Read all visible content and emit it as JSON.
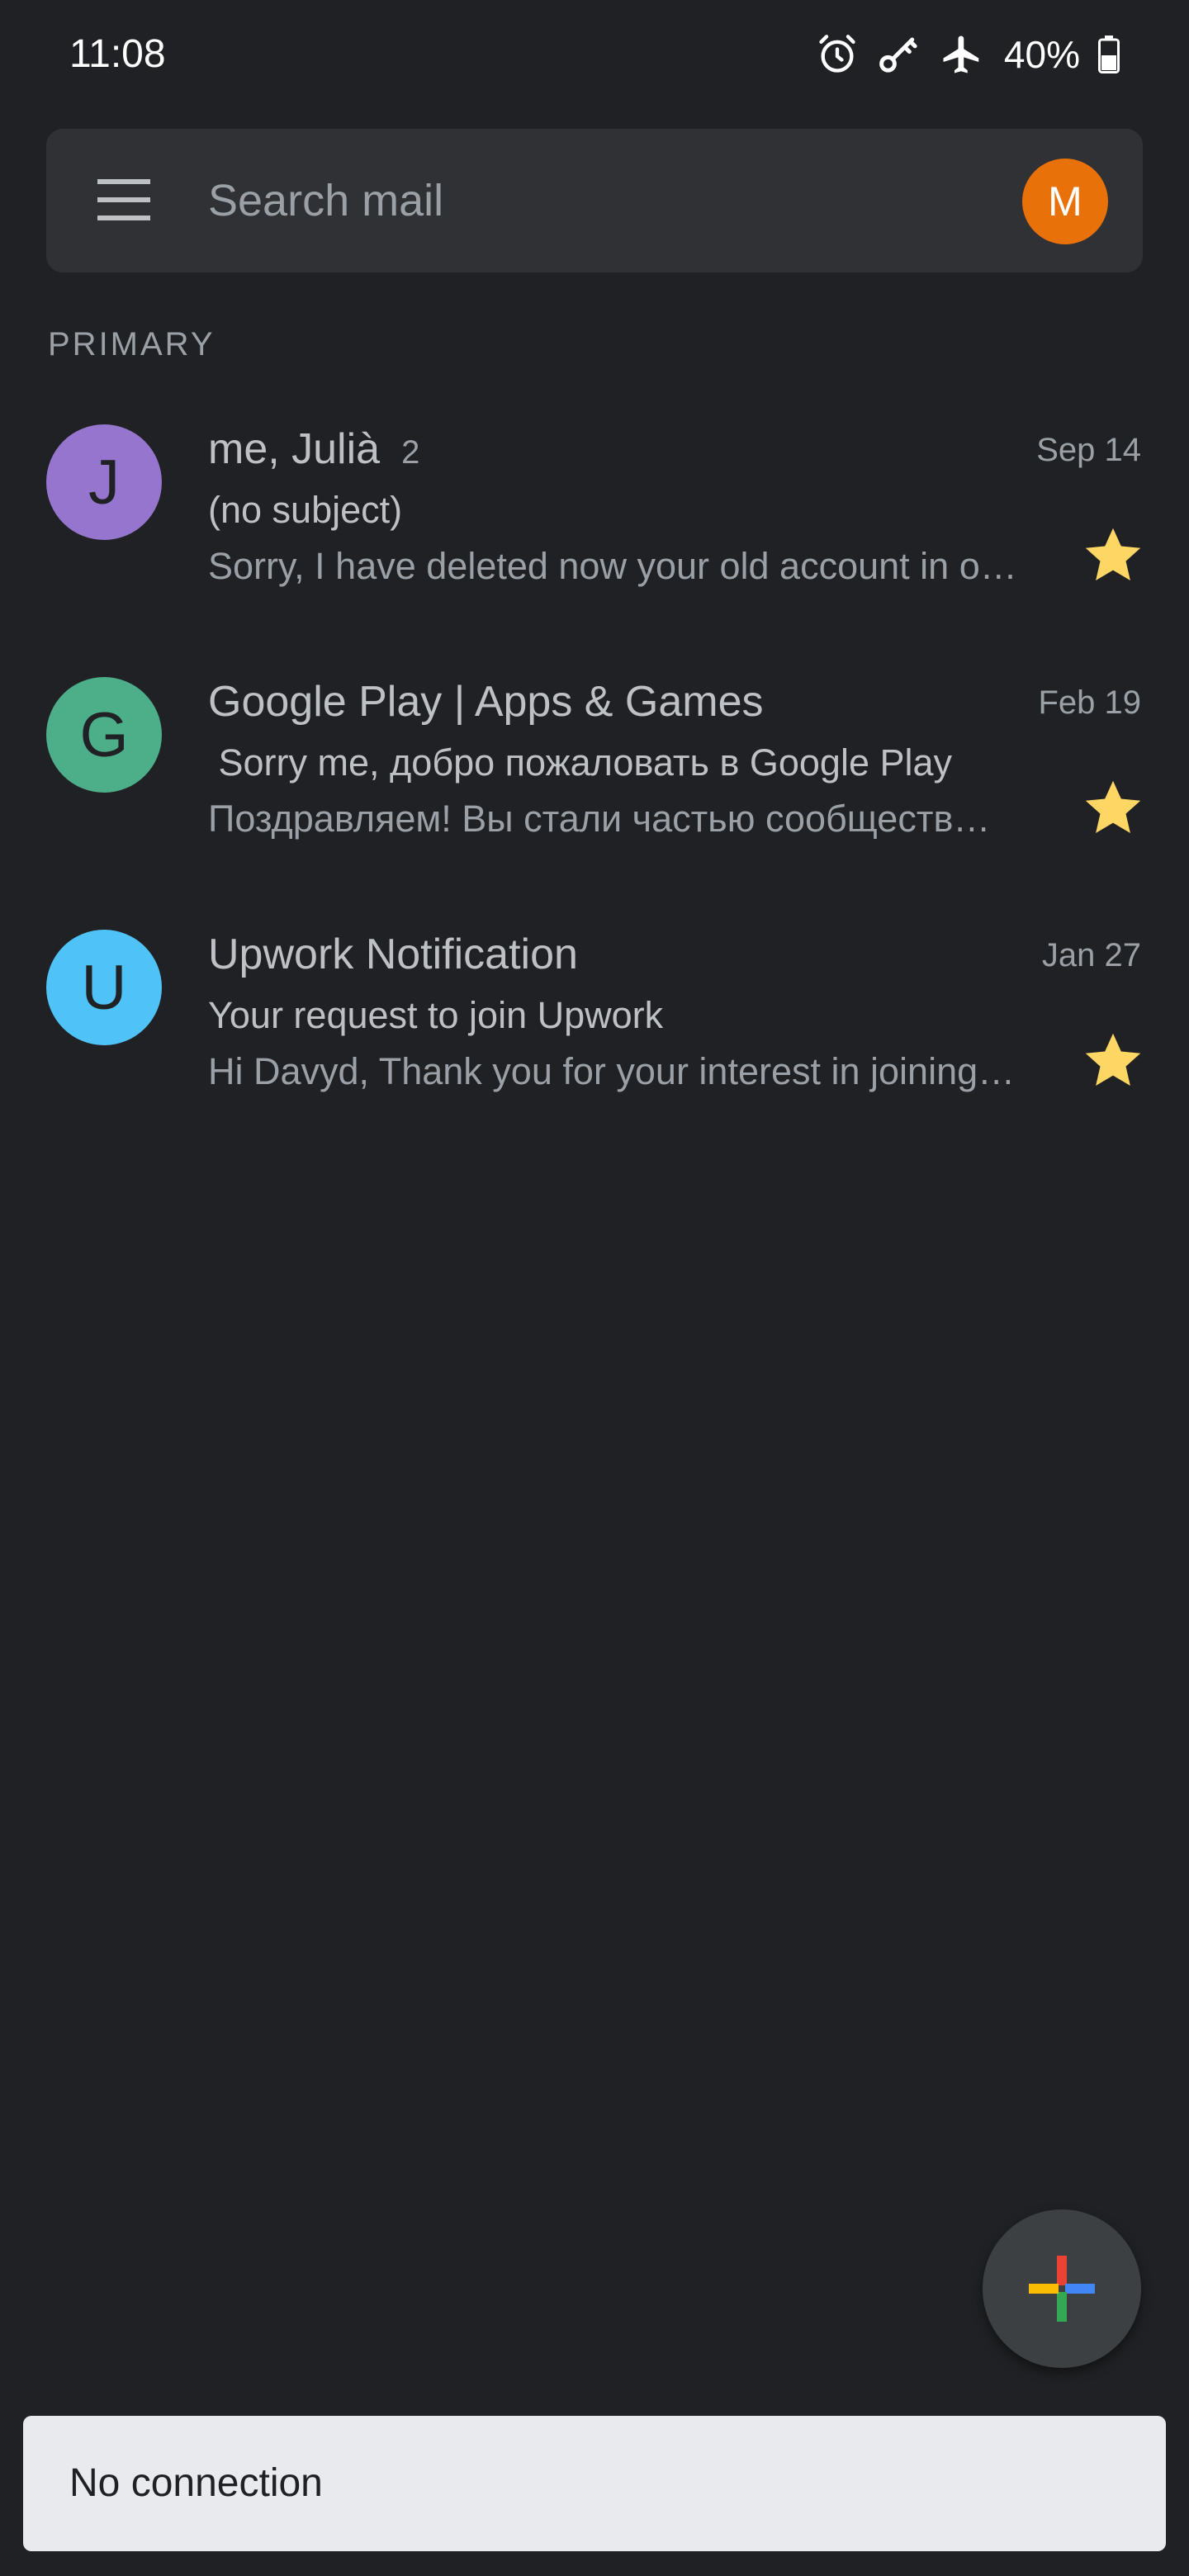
{
  "status_bar": {
    "time": "11:08",
    "battery": "40%",
    "icons": [
      "alarm-icon",
      "vpn-key-icon",
      "airplane-mode-icon",
      "battery-icon"
    ]
  },
  "search": {
    "placeholder": "Search mail",
    "account_initial": "M",
    "account_color": "#e8710a"
  },
  "section": {
    "label": "PRIMARY"
  },
  "emails": [
    {
      "initial": "J",
      "avatar_color": "#9575cd",
      "sender": "me, Julià",
      "count": "2",
      "date": "Sep 14",
      "subject": "(no subject)",
      "snippet": "Sorry, I have deleted now your old account in o…",
      "starred": true
    },
    {
      "initial": "G",
      "avatar_color": "#4caf8a",
      "sender": "Google Play | Apps & Games",
      "count": "",
      "date": "Feb 19",
      "subject": " Sorry me, добро пожаловать в Google Play",
      "snippet": "Поздравляем! Вы стали частью сообществ…",
      "starred": true
    },
    {
      "initial": "U",
      "avatar_color": "#4fc3f7",
      "sender": "Upwork Notification",
      "count": "",
      "date": "Jan 27",
      "subject": "Your request to join Upwork",
      "snippet": "Hi Davyd, Thank you for your interest in joining…",
      "starred": true
    }
  ],
  "colors": {
    "background": "#202124",
    "star": "#fdd663"
  },
  "snackbar": {
    "text": "No connection"
  }
}
